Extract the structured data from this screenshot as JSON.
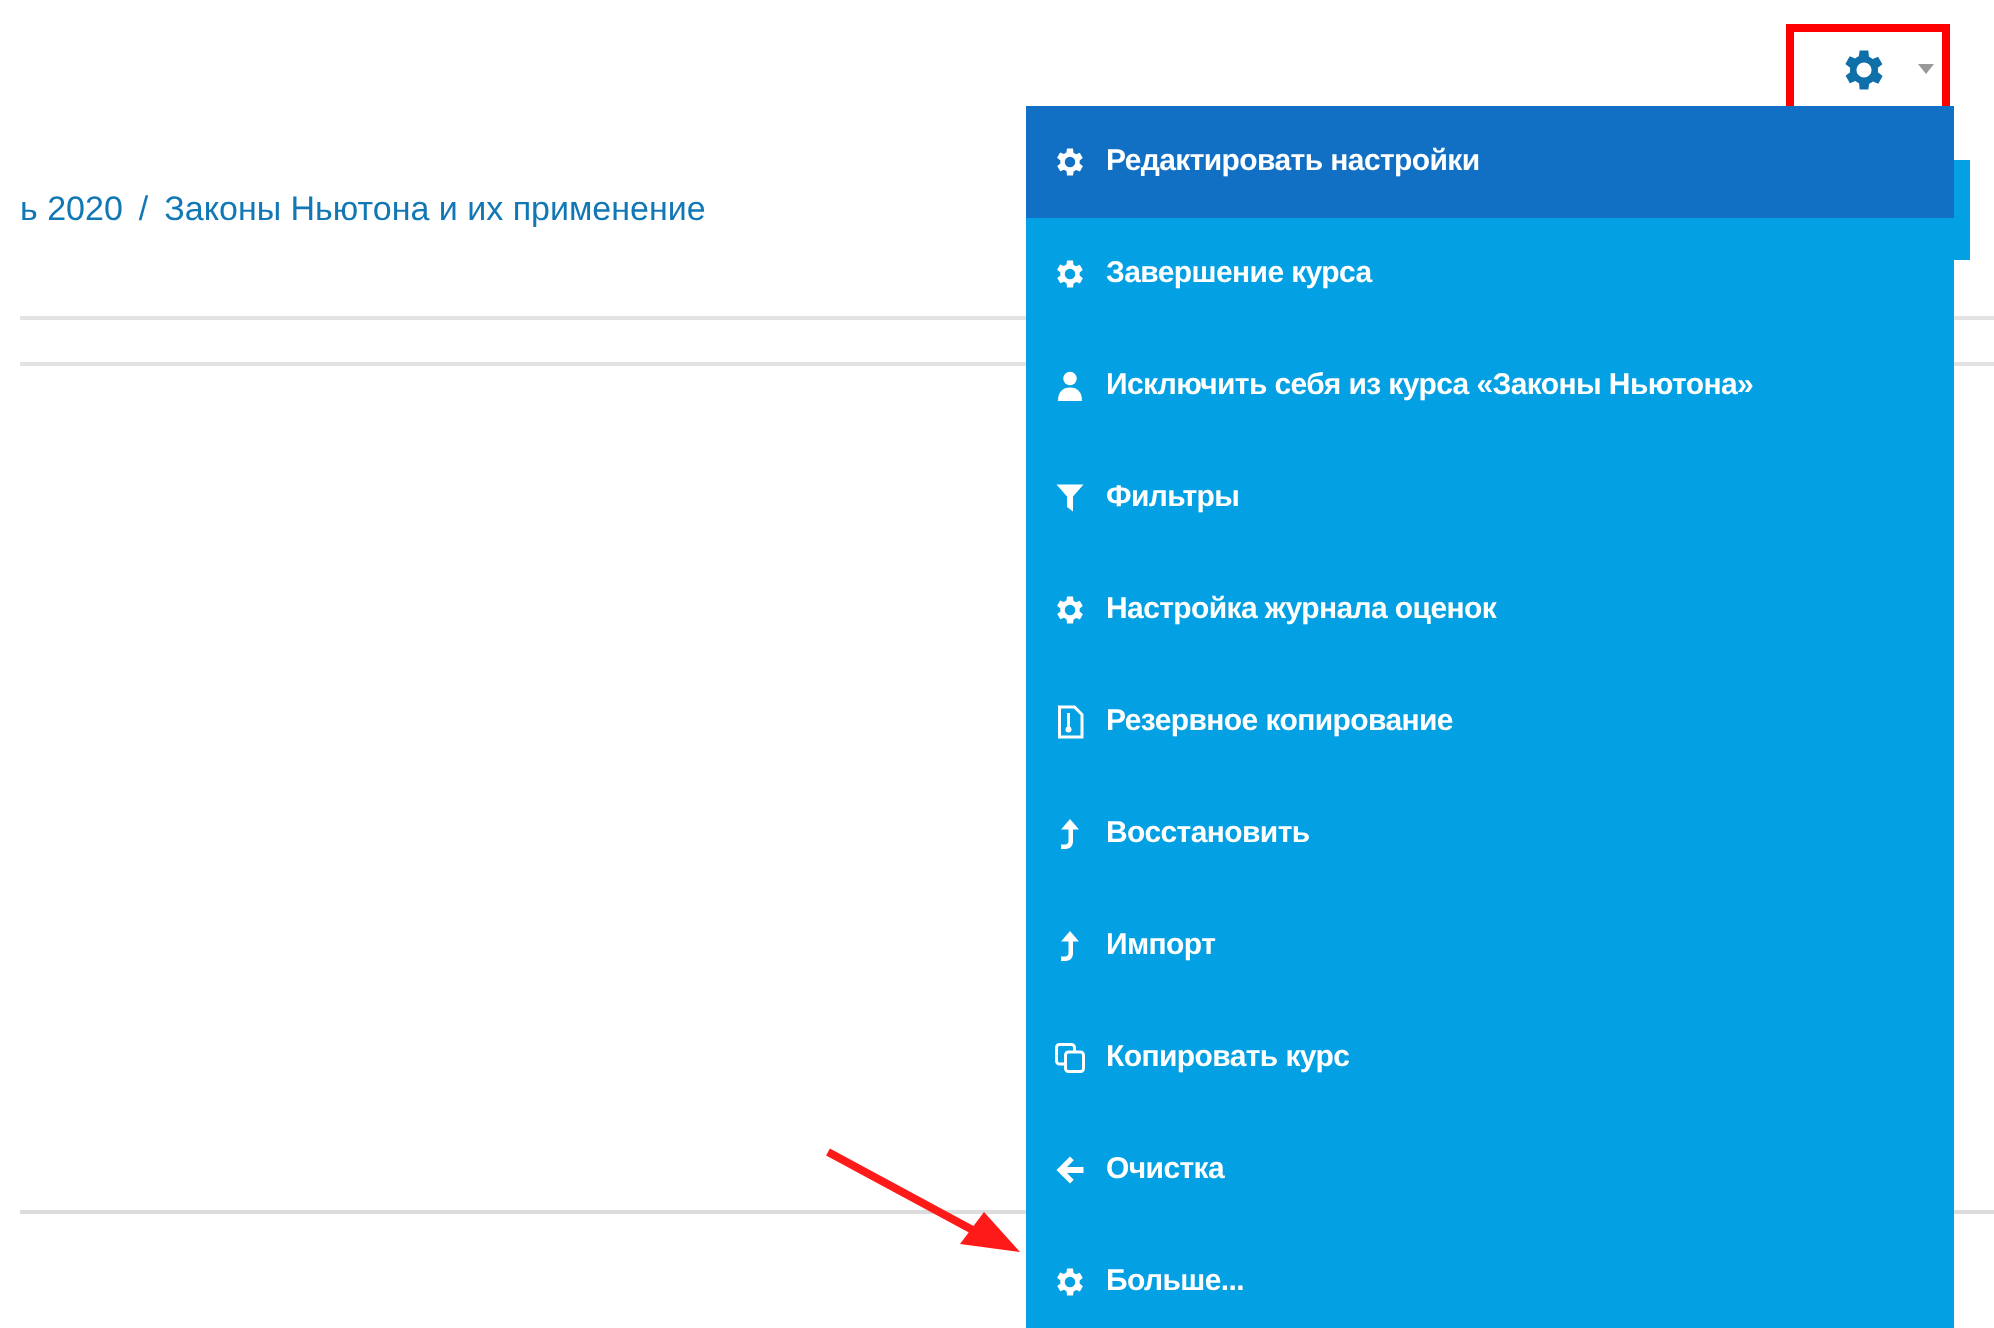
{
  "breadcrumb": [
    {
      "label": "ь 2020"
    },
    {
      "label": "Законы Ньютона и их применение"
    }
  ],
  "breadcrumb_separator": "/",
  "settings_menu": {
    "items": [
      {
        "label": "Редактировать настройки",
        "kind": "gear",
        "selected": true
      },
      {
        "label": "Завершение курса",
        "kind": "gear",
        "selected": false
      },
      {
        "label": "Исключить себя из курса «Законы Ньютона»",
        "kind": "user",
        "selected": false
      },
      {
        "label": "Фильтры",
        "kind": "filter",
        "selected": false
      },
      {
        "label": "Настройка журнала оценок",
        "kind": "gear",
        "selected": false
      },
      {
        "label": "Резервное копирование",
        "kind": "file",
        "selected": false
      },
      {
        "label": "Восстановить",
        "kind": "upload",
        "selected": false
      },
      {
        "label": "Импорт",
        "kind": "upload",
        "selected": false
      },
      {
        "label": "Копировать курс",
        "kind": "copy",
        "selected": false
      },
      {
        "label": "Очистка",
        "kind": "arrow-left",
        "selected": false
      },
      {
        "label": "Больше...",
        "kind": "gear",
        "selected": false
      }
    ]
  }
}
